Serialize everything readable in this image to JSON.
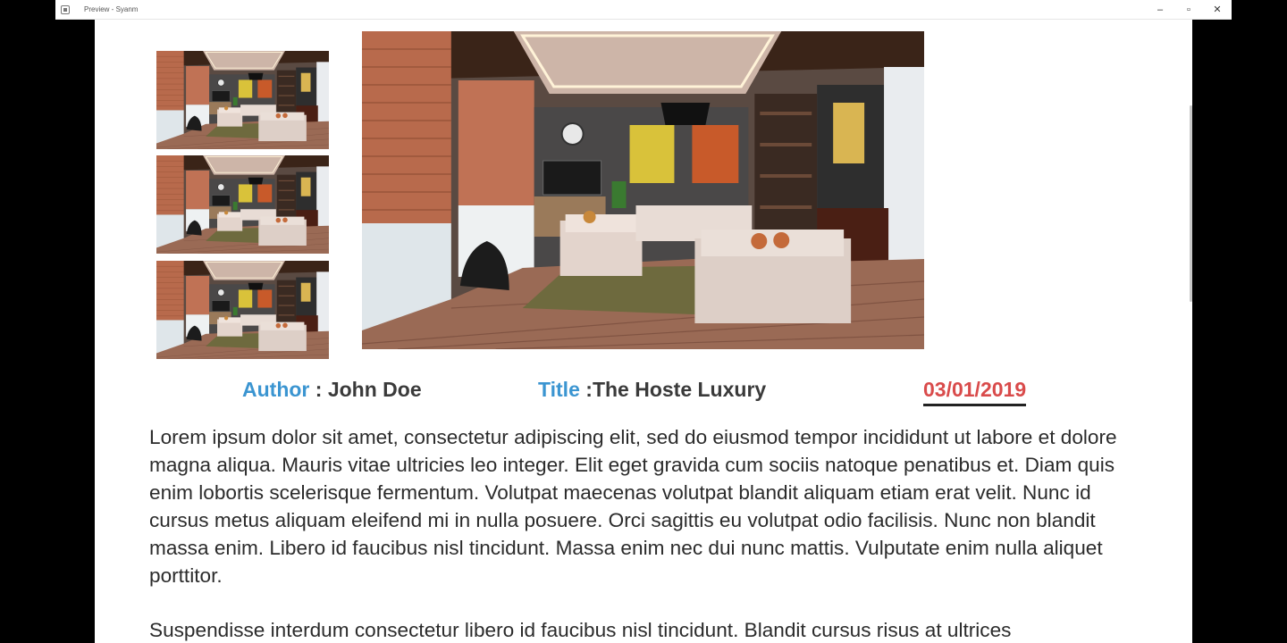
{
  "window": {
    "title": "Preview - Syanm",
    "controls": {
      "minimize": "–",
      "maximize": "▫",
      "close": "✕"
    }
  },
  "gallery": {
    "thumbnails": [
      "living-room",
      "living-room",
      "living-room"
    ],
    "main_image": "living-room"
  },
  "meta": {
    "author_label": "Author",
    "author_sep": " : ",
    "author_value": "John Doe",
    "title_label": "Title",
    "title_sep": " :",
    "title_value": "The Hoste Luxury",
    "date": "03/01/2019"
  },
  "body": {
    "paragraph1": "Lorem ipsum dolor sit amet, consectetur adipiscing elit, sed do eiusmod tempor incididunt ut labore et dolore magna aliqua. Mauris vitae ultricies leo integer. Elit eget gravida cum sociis natoque penatibus et. Diam quis enim lobortis scelerisque fermentum. Volutpat maecenas volutpat blandit aliquam etiam erat velit. Nunc id cursus metus aliquam eleifend mi in nulla posuere. Orci sagittis eu volutpat odio facilisis. Nunc non blandit massa enim. Libero id faucibus nisl tincidunt. Massa enim nec dui nunc mattis. Vulputate enim nulla aliquet porttitor.",
    "paragraph2": "Suspendisse interdum consectetur libero id faucibus nisl tincidunt. Blandit cursus risus at ultrices"
  },
  "colors": {
    "label_blue": "#3b95d1",
    "date_red": "#d94b4b",
    "text": "#2b2b2b"
  }
}
